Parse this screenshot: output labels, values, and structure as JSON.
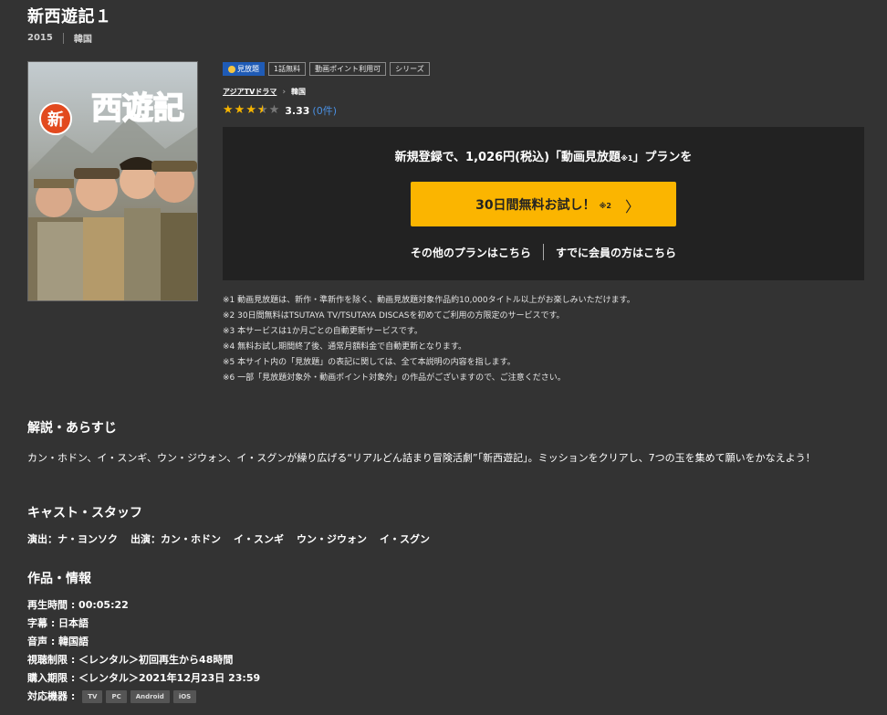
{
  "title": "新西遊記１",
  "meta": {
    "year": "2015",
    "country": "韓国"
  },
  "poster": {
    "logo_small": "新",
    "logo_main": "西遊記"
  },
  "badges": [
    "見放題",
    "1話無料",
    "動画ポイント利用可",
    "シリーズ"
  ],
  "breadcrumb": {
    "genre": "アジアTVドラマ",
    "country": "韓国"
  },
  "rating": {
    "stars": 3.5,
    "score": "3.33",
    "count": "(0件)"
  },
  "plan": {
    "headline_pre": "新規登録で、1,026円(税込)「動画見放題",
    "headline_note": "※1",
    "headline_post": "」プランを",
    "trial_label": "30日間無料お試し！",
    "trial_note": "※2",
    "other_plans": "その他のプランはこちら",
    "members": "すでに会員の方はこちら"
  },
  "notes": [
    "※1 動画見放題は、新作・準新作を除く、動画見放題対象作品約10,000タイトル以上がお楽しみいただけます。",
    "※2 30日間無料はTSUTAYA TV/TSUTAYA DISCASを初めてご利用の方限定のサービスです。",
    "※3 本サービスは1か月ごとの自動更新サービスです。",
    "※4 無料お試し期間終了後、通常月額料金で自動更新となります。",
    "※5 本サイト内の「見放題」の表記に関しては、全て本説明の内容を指します。",
    "※6 一部「見放題対象外・動画ポイント対象外」の作品がございますので、ご注意ください。"
  ],
  "synopsis": {
    "heading": "解説・あらすじ",
    "text": "カン・ホドン、イ・スンギ、ウン・ジウォン、イ・スグンが繰り広げる“リアルどん詰まり冒険活劇”「新西遊記」。ミッションをクリアし、7つの玉を集めて願いをかなえよう！"
  },
  "cast": {
    "heading": "キャスト・スタッフ",
    "director": "演出：ナ・ヨンソク",
    "performers": [
      "出演：カン・ホドン",
      "イ・スンギ",
      "ウン・ジウォン",
      "イ・スグン"
    ]
  },
  "info": {
    "heading": "作品・情報",
    "runtime": "再生時間 : 00:05:22",
    "subtitles": "字幕 : 日本語",
    "audio": "音声 : 韓国語",
    "viewing_limit": "視聴制限 : ＜レンタル＞初回再生から48時間",
    "purchase_limit": "購入期限 : ＜レンタル＞2021年12月23日 23:59",
    "devices_label": "対応機器 :",
    "devices": [
      "TV",
      "PC",
      "Android",
      "iOS"
    ]
  }
}
